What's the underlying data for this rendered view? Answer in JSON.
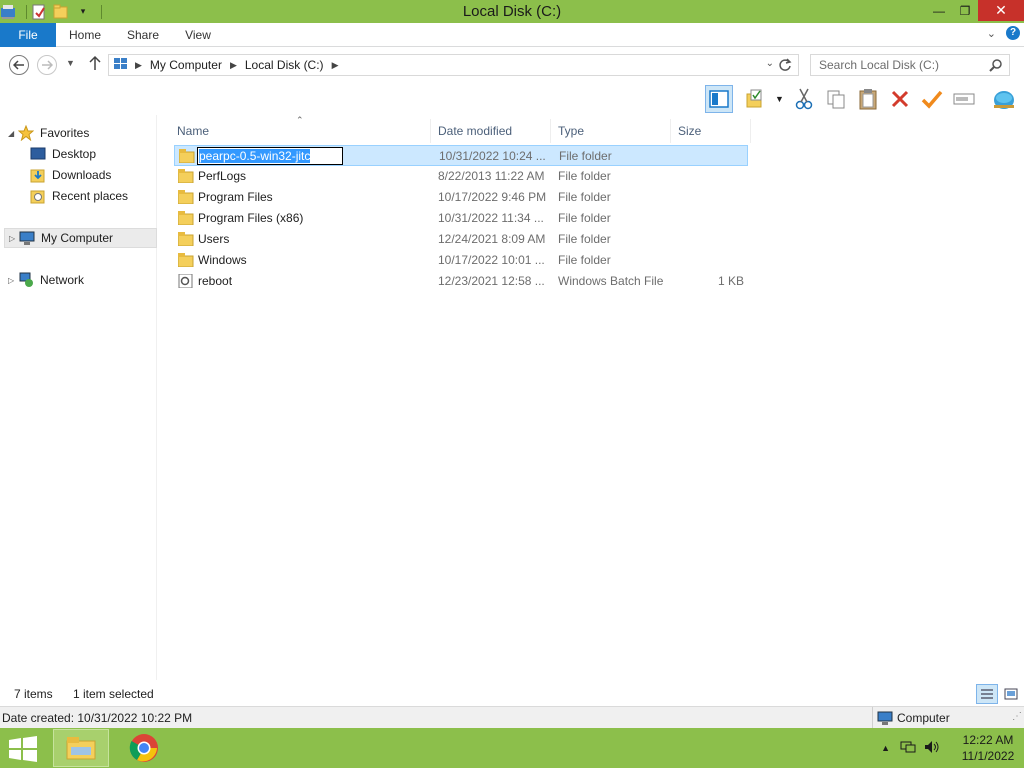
{
  "window": {
    "title": "Local Disk (C:)",
    "controls": {
      "minimize": "—",
      "maximize": "❐",
      "close": "✕"
    }
  },
  "ribbon": {
    "tabs": [
      "File",
      "Home",
      "Share",
      "View"
    ],
    "help": "?"
  },
  "address": {
    "crumbs": [
      "My Computer",
      "Local Disk (C:)"
    ],
    "search_placeholder": "Search Local Disk (C:)"
  },
  "nav_pane": {
    "favorites": "Favorites",
    "favorite_items": [
      "Desktop",
      "Downloads",
      "Recent places"
    ],
    "computer": "My Computer",
    "network": "Network"
  },
  "columns": [
    "Name",
    "Date modified",
    "Type",
    "Size"
  ],
  "files": [
    {
      "name": "pearpc-0.5-win32-jitc",
      "date": "10/31/2022 10:24 ...",
      "type": "File folder",
      "size": "",
      "icon": "folder-icon",
      "renaming": true
    },
    {
      "name": "PerfLogs",
      "date": "8/22/2013 11:22 AM",
      "type": "File folder",
      "size": "",
      "icon": "folder-icon"
    },
    {
      "name": "Program Files",
      "date": "10/17/2022 9:46 PM",
      "type": "File folder",
      "size": "",
      "icon": "folder-icon"
    },
    {
      "name": "Program Files (x86)",
      "date": "10/31/2022 11:34 ...",
      "type": "File folder",
      "size": "",
      "icon": "folder-icon"
    },
    {
      "name": "Users",
      "date": "12/24/2021 8:09 AM",
      "type": "File folder",
      "size": "",
      "icon": "folder-icon"
    },
    {
      "name": "Windows",
      "date": "10/17/2022 10:01 ...",
      "type": "File folder",
      "size": "",
      "icon": "folder-icon"
    },
    {
      "name": "reboot",
      "date": "12/23/2021 12:58 ...",
      "type": "Windows Batch File",
      "size": "1 KB",
      "icon": "batch-file-icon"
    }
  ],
  "status": {
    "item_count": "7 items",
    "selected": "1 item selected",
    "date_created": "Date created: 10/31/2022 10:22 PM",
    "location": "Computer"
  },
  "taskbar": {
    "time": "12:22 AM",
    "date": "11/1/2022"
  },
  "colors": {
    "titlebar": "#8cbf4b",
    "file_tab": "#1979ca",
    "close": "#c7312a",
    "selection": "#cce8ff"
  }
}
